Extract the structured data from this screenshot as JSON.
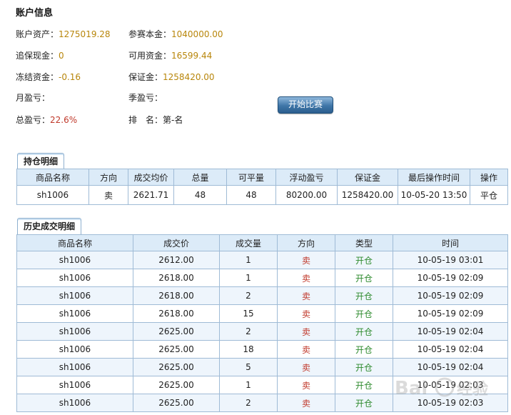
{
  "account": {
    "title": "账户信息",
    "fields": {
      "assets": {
        "label": "账户资产：",
        "value": "1275019.28"
      },
      "capital": {
        "label": "参赛本金：",
        "value": "1040000.00"
      },
      "margin_call": {
        "label": "追保现金：",
        "value": "0"
      },
      "available": {
        "label": "可用资金：",
        "value": "16599.44"
      },
      "frozen": {
        "label": "冻结资金：",
        "value": "-0.16"
      },
      "deposit": {
        "label": "保证金：",
        "value": "1258420.00"
      },
      "month_pl": {
        "label": "月盈亏：",
        "value": ""
      },
      "quarter_pl": {
        "label": "季盈亏：",
        "value": ""
      },
      "total_pl": {
        "label": "总盈亏：",
        "value": "22.6%"
      },
      "rank": {
        "label": "排　名：",
        "value": "第-名"
      }
    },
    "start_button": "开始比赛"
  },
  "positions": {
    "tab": "持仓明细",
    "headers": [
      "商品名称",
      "方向",
      "成交均价",
      "总量",
      "可平量",
      "浮动盈亏",
      "保证金",
      "最后操作时间",
      "操作"
    ],
    "rows": [
      [
        "sh1006",
        "卖",
        "2621.71",
        "48",
        "48",
        "80200.00",
        "1258420.00",
        "10-05-20 13:50",
        "平仓"
      ]
    ]
  },
  "history": {
    "tab": "历史成交明细",
    "headers": [
      "商品名称",
      "成交价",
      "成交量",
      "方向",
      "类型",
      "时间"
    ],
    "rows": [
      [
        "sh1006",
        "2612.00",
        "1",
        "卖",
        "开仓",
        "10-05-19 03:01"
      ],
      [
        "sh1006",
        "2618.00",
        "1",
        "卖",
        "开仓",
        "10-05-19 02:09"
      ],
      [
        "sh1006",
        "2618.00",
        "2",
        "卖",
        "开仓",
        "10-05-19 02:09"
      ],
      [
        "sh1006",
        "2618.00",
        "15",
        "卖",
        "开仓",
        "10-05-19 02:09"
      ],
      [
        "sh1006",
        "2625.00",
        "2",
        "卖",
        "开仓",
        "10-05-19 02:04"
      ],
      [
        "sh1006",
        "2625.00",
        "18",
        "卖",
        "开仓",
        "10-05-19 02:04"
      ],
      [
        "sh1006",
        "2625.00",
        "5",
        "卖",
        "开仓",
        "10-05-19 02:04"
      ],
      [
        "sh1006",
        "2625.00",
        "1",
        "卖",
        "开仓",
        "10-05-19 02:03"
      ],
      [
        "sh1006",
        "2625.00",
        "2",
        "卖",
        "开仓",
        "10-05-19 02:03"
      ]
    ]
  },
  "colors": {
    "value": "#b8860b",
    "negative": "#c0392b",
    "open_type": "#2e8b2e",
    "header_bg": "#dcebf8",
    "border": "#9fbbd6"
  }
}
